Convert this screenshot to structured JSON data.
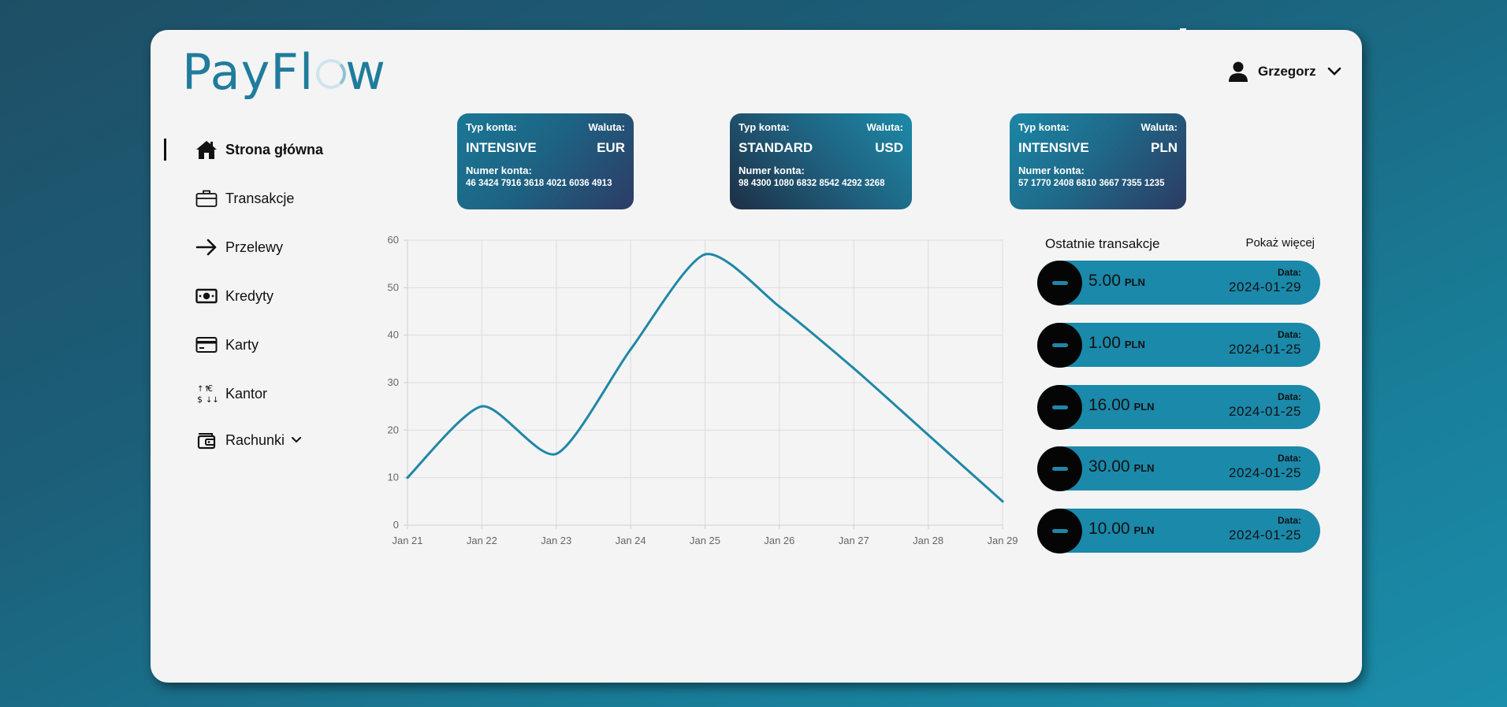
{
  "brand": {
    "name_prefix": "PayFl",
    "name_suffix": "w"
  },
  "user": {
    "name": "Grzegorz"
  },
  "nav": {
    "items": [
      {
        "label": "Strona główna",
        "icon": "home-icon",
        "active": true
      },
      {
        "label": "Transakcje",
        "icon": "briefcase-icon"
      },
      {
        "label": "Przelewy",
        "icon": "arrow-right-icon"
      },
      {
        "label": "Kredyty",
        "icon": "banknote-icon"
      },
      {
        "label": "Karty",
        "icon": "credit-card-icon"
      },
      {
        "label": "Kantor",
        "icon": "currency-exchange-icon"
      },
      {
        "label": "Rachunki",
        "icon": "wallet-icon",
        "has_dropdown": true
      }
    ]
  },
  "accounts": [
    {
      "type_label": "Typ konta:",
      "currency_label": "Waluta:",
      "type": "INTENSIVE",
      "currency": "EUR",
      "number_label": "Numer konta:",
      "number": "46 3424 7916 3618 4021 6036 4913"
    },
    {
      "type_label": "Typ konta:",
      "currency_label": "Waluta:",
      "type": "STANDARD",
      "currency": "USD",
      "number_label": "Numer konta:",
      "number": "98 4300 1080 6832 8542 4292 3268"
    },
    {
      "type_label": "Typ konta:",
      "currency_label": "Waluta:",
      "type": "INTENSIVE",
      "currency": "PLN",
      "number_label": "Numer konta:",
      "number": "57 1770 2408 6810 3667 7355 1235"
    }
  ],
  "chart_data": {
    "type": "line",
    "categories": [
      "Jan 21",
      "Jan 22",
      "Jan 23",
      "Jan 24",
      "Jan 25",
      "Jan 26",
      "Jan 27",
      "Jan 28",
      "Jan 29"
    ],
    "series": [
      {
        "values": [
          10,
          25,
          15,
          37,
          57,
          46,
          33,
          19,
          5
        ]
      }
    ],
    "ylim": [
      0,
      60
    ],
    "yticks": [
      0,
      10,
      20,
      30,
      40,
      50,
      60
    ],
    "grid": true,
    "line_color": "#2087a6"
  },
  "transactions": {
    "title": "Ostatnie transakcje",
    "more_label": "Pokaż więcej",
    "items": [
      {
        "amount": "5.00",
        "currency": "PLN",
        "date_label": "Data:",
        "date": "2024-01-29"
      },
      {
        "amount": "1.00",
        "currency": "PLN",
        "date_label": "Data:",
        "date": "2024-01-25"
      },
      {
        "amount": "16.00",
        "currency": "PLN",
        "date_label": "Data:",
        "date": "2024-01-25"
      },
      {
        "amount": "30.00",
        "currency": "PLN",
        "date_label": "Data:",
        "date": "2024-01-25"
      },
      {
        "amount": "10.00",
        "currency": "PLN",
        "date_label": "Data:",
        "date": "2024-01-25"
      }
    ]
  },
  "colors": {
    "accent": "#1f7c9d",
    "tx_pill": "#1a89aa"
  }
}
